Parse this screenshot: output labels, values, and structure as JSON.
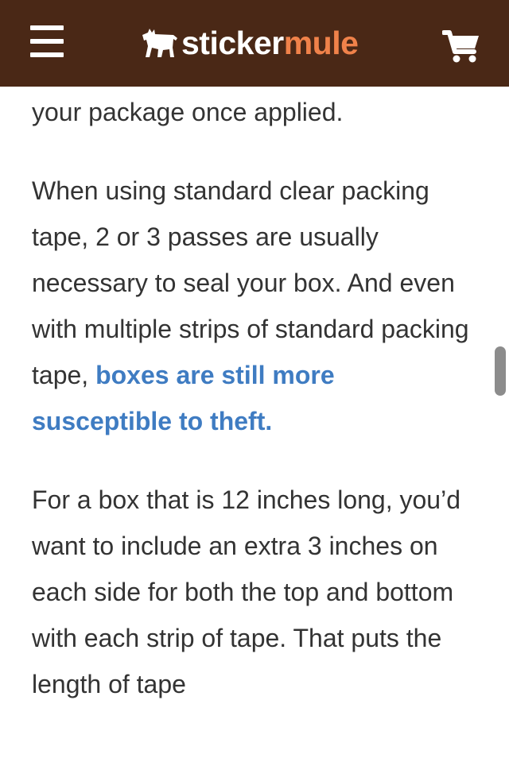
{
  "header": {
    "logo_sticker": "sticker",
    "logo_mule": "mule",
    "menu_icon": "hamburger-menu-icon",
    "cart_icon": "shopping-cart-icon",
    "background_color": "#4a2816",
    "accent_color": "#f0824a"
  },
  "article": {
    "p1_text": "your package once applied.",
    "p2_text_before": "When using standard clear packing tape, 2 or 3 passes are usually necessary to seal your box. And even with multiple strips of standard packing tape, ",
    "p2_highlight": "boxes are still more susceptible to theft.",
    "p3_text": "For a box that is 12 inches long, you’d want to include an extra 3 inches on each side for both the top and bottom with each strip of tape. That puts the length of tape",
    "highlight_color": "#3f7cc2"
  }
}
